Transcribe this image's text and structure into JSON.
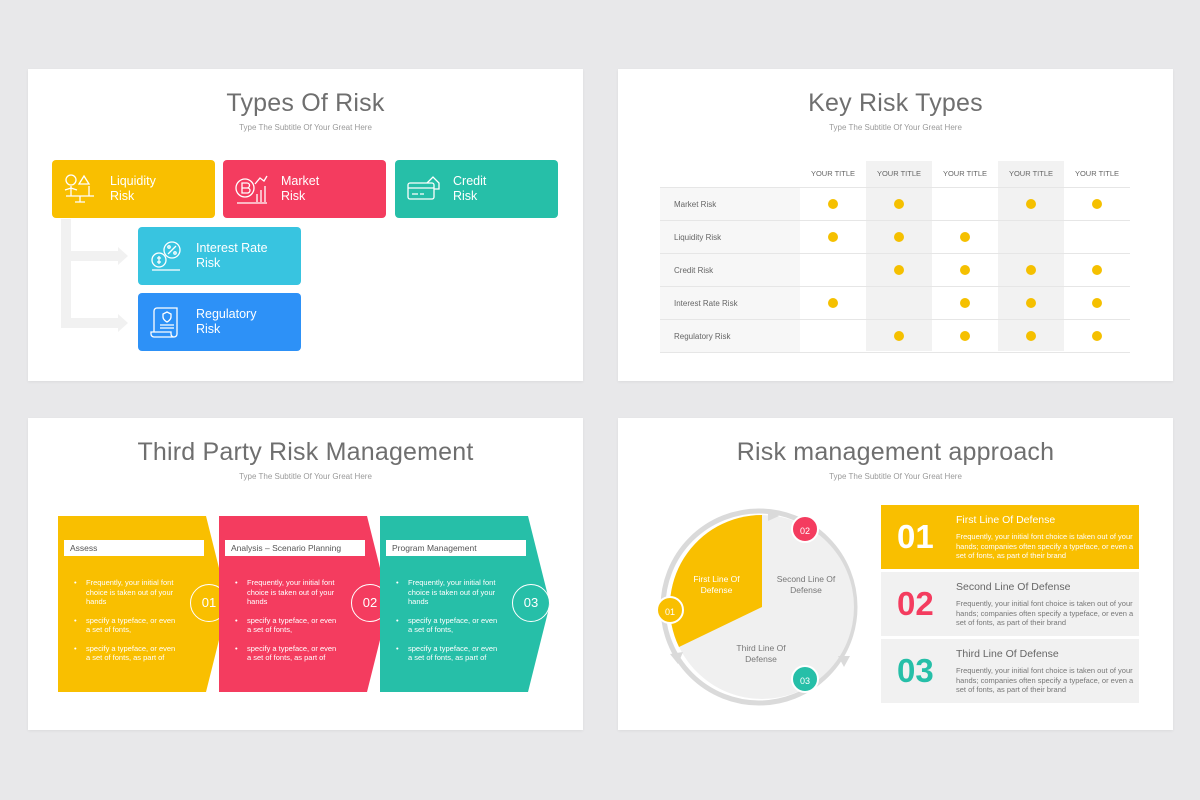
{
  "colors": {
    "yellow": "#f9bf00",
    "red": "#f43c5f",
    "teal": "#26bfa8",
    "cyan": "#38c4e0",
    "blue": "#2d91f7",
    "dot": "#f5c000",
    "grey_text": "#6f6f6f"
  },
  "slide1": {
    "title": "Types Of Risk",
    "subtitle": "Type The Subtitle Of Your Great Here",
    "boxes": [
      {
        "label_line1": "Liquidity",
        "label_line2": "Risk",
        "icon": "balance-scale-icon"
      },
      {
        "label_line1": "Market",
        "label_line2": "Risk",
        "icon": "bitcoin-chart-icon"
      },
      {
        "label_line1": "Credit",
        "label_line2": "Risk",
        "icon": "credit-card-icon"
      },
      {
        "label_line1": "Interest Rate",
        "label_line2": "Risk",
        "icon": "percent-coins-icon"
      },
      {
        "label_line1": "Regulatory",
        "label_line2": "Risk",
        "icon": "document-scroll-icon"
      }
    ]
  },
  "slide2": {
    "title": "Key Risk Types",
    "subtitle": "Type The Subtitle Of Your Great Here",
    "columns": [
      "YOUR TITLE",
      "YOUR TITLE",
      "YOUR TITLE",
      "YOUR TITLE",
      "YOUR TITLE"
    ],
    "rows": [
      {
        "label": "Market Risk",
        "marks": [
          true,
          true,
          false,
          true,
          true
        ]
      },
      {
        "label": "Liquidity Risk",
        "marks": [
          true,
          true,
          true,
          false,
          false
        ]
      },
      {
        "label": "Credit Risk",
        "marks": [
          false,
          true,
          true,
          true,
          true
        ]
      },
      {
        "label": "Interest Rate Risk",
        "marks": [
          true,
          false,
          true,
          true,
          true
        ]
      },
      {
        "label": "Regulatory Risk",
        "marks": [
          false,
          true,
          true,
          true,
          true
        ]
      }
    ]
  },
  "slide3": {
    "title": "Third Party Risk Management",
    "subtitle": "Type The Subtitle Of Your Great Here",
    "steps": [
      {
        "heading": "Assess",
        "number": "01",
        "bullets": [
          "Frequently, your initial font choice is taken out of your hands",
          "specify a typeface, or even a set of fonts,",
          "specify a typeface, or even a set of fonts, as part of"
        ]
      },
      {
        "heading": "Analysis – Scenario Planning",
        "number": "02",
        "bullets": [
          "Frequently, your initial font choice is taken out of your hands",
          "specify a typeface, or even a set of fonts,",
          "specify a typeface, or even a set of fonts, as part of"
        ]
      },
      {
        "heading": "Program Management",
        "number": "03",
        "bullets": [
          "Frequently, your initial font choice is taken out of your hands",
          "specify a typeface, or even a set of fonts,",
          "specify a typeface, or even a set of fonts, as part of"
        ]
      }
    ]
  },
  "slide4": {
    "title": "Risk management approach",
    "subtitle": "Type The Subtitle Of Your Great Here",
    "circle": {
      "seg1_line1": "First Line Of",
      "seg1_line2": "Defense",
      "seg2_line1": "Second Line Of",
      "seg2_line2": "Defense",
      "seg3_line1": "Third Line Of",
      "seg3_line2": "Defense",
      "badge1": "01",
      "badge2": "02",
      "badge3": "03"
    },
    "defenses": [
      {
        "number": "01",
        "title": "First Line Of Defense",
        "desc": "Frequently, your initial font choice is taken out of your hands; companies often specify a typeface, or even a set of fonts, as part of their brand"
      },
      {
        "number": "02",
        "title": "Second Line Of Defense",
        "desc": "Frequently, your initial font choice is taken out of your hands; companies often specify a typeface, or even a set of fonts, as part of their brand"
      },
      {
        "number": "03",
        "title": "Third Line Of Defense",
        "desc": "Frequently, your initial font choice is taken out of your hands; companies often specify a typeface, or even a set of fonts, as part of their brand"
      }
    ]
  }
}
